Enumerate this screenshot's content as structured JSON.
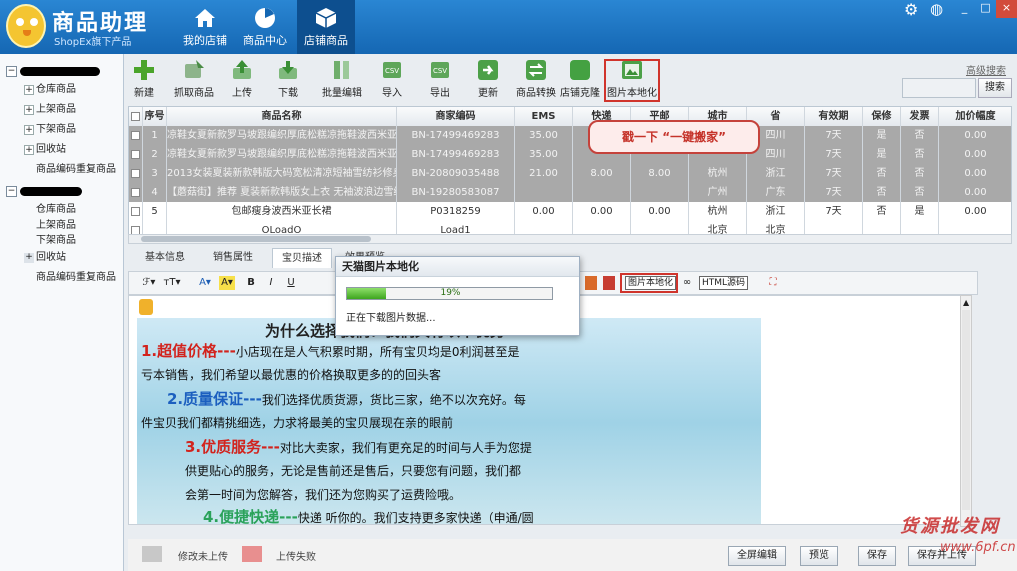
{
  "app": {
    "title": "商品助理",
    "subtitle": "ShopEx旗下产品"
  },
  "nav": [
    {
      "label": "我的店铺",
      "icon": "home-icon"
    },
    {
      "label": "商品中心",
      "icon": "pie-chart-icon"
    },
    {
      "label": "店铺商品",
      "icon": "box-icon",
      "active": true
    }
  ],
  "window": {
    "min": "_",
    "restore": "□",
    "close": "×"
  },
  "sidebar": {
    "groups": [
      {
        "items": [
          "仓库商品",
          "上架商品",
          "下架商品",
          "回收站",
          "商品编码重复商品"
        ]
      },
      {
        "items": [
          "仓库商品",
          "上架商品",
          "下架商品",
          "回收站",
          "商品编码重复商品"
        ]
      }
    ]
  },
  "toolbar": {
    "buttons": [
      "新建",
      "抓取商品",
      "上传",
      "下载",
      "批量编辑",
      "导入",
      "导出",
      "更新",
      "商品转换",
      "店铺克隆",
      "图片本地化"
    ],
    "advanced_search": "高级搜索",
    "search_button": "搜索"
  },
  "grid": {
    "columns": [
      "序号",
      "商品名称",
      "商家编码",
      "EMS",
      "快递",
      "平邮",
      "城市",
      "省",
      "有效期",
      "保修",
      "发票",
      "加价幅度"
    ],
    "rows": [
      [
        "1",
        "凉鞋女夏新款罗马坡跟编织厚底松糕凉拖鞋波西米亚",
        "BN-17499469283",
        "35.00",
        "",
        "",
        "",
        "四川",
        "7天",
        "是",
        "否",
        "0.00"
      ],
      [
        "2",
        "凉鞋女夏新款罗马坡跟编织厚底松糕凉拖鞋波西米亚",
        "BN-17499469283",
        "35.00",
        "",
        "",
        "",
        "四川",
        "7天",
        "是",
        "否",
        "0.00"
      ],
      [
        "3",
        "2013女装夏装新款韩版大码宽松清凉短袖雪纺衫修身",
        "BN-20809035488",
        "21.00",
        "8.00",
        "8.00",
        "杭州",
        "浙江",
        "7天",
        "否",
        "否",
        "0.00"
      ],
      [
        "4",
        "【蘑菇街】推荐 夏装新款韩版女上衣 无袖波浪边雪纺",
        "BN-19280583087",
        "",
        "",
        "",
        "广州",
        "广东",
        "7天",
        "否",
        "否",
        "0.00"
      ],
      [
        "5",
        "包邮瘦身波西米亚长裙",
        "P0318259",
        "0.00",
        "0.00",
        "0.00",
        "杭州",
        "浙江",
        "7天",
        "否",
        "是",
        "0.00"
      ],
      [
        "",
        "OLoadO",
        "Load1",
        "",
        "",
        "",
        "北京",
        "北京",
        "",
        "",
        "",
        ""
      ]
    ]
  },
  "callout": "戳一下 “一键搬家”",
  "tabs": [
    "基本信息",
    "销售属性",
    "宝贝描述",
    "效果预览"
  ],
  "editor_toolbar": {
    "image_localize": "图片本地化",
    "html_source": "HTML源码",
    "bold": "B",
    "italic": "I",
    "underline": "U"
  },
  "dialog": {
    "title": "天猫图片本地化",
    "progress": 0.19,
    "progress_text": "19%",
    "status": "正在下载图片数据..."
  },
  "banner": {
    "title": "为什么选择我们？我们具有以下优势",
    "lines": [
      {
        "head": "1.超值价格---",
        "text": "小店现在是人气积累时期，所有宝贝均是0利润甚至是"
      },
      {
        "head": "",
        "text": "亏本销售，我们希望以最优惠的价格换取更多的的回头客"
      },
      {
        "head": "2.质量保证---",
        "text": "我们选择优质货源，货比三家，绝不以次充好。每"
      },
      {
        "head": "",
        "text": "件宝贝我们都精挑细选，力求将最美的宝贝展现在亲的眼前"
      },
      {
        "head": "3.优质服务---",
        "text": "对比大卖家，我们有更充足的时间与人手为您提"
      },
      {
        "head": "",
        "text": "供更贴心的服务，无论是售前还是售后，只要您有问题，我们都"
      },
      {
        "head": "",
        "text": "会第一时间为您解答，我们还为您购买了运费险哦。"
      },
      {
        "head": "4.便捷快递---",
        "text": "快递 听你的。我们支持更多家快递（申通/圆"
      }
    ]
  },
  "bottom": {
    "legend": [
      {
        "label": "修改未上传",
        "color": "#c8c8c8"
      },
      {
        "label": "上传失败",
        "color": "#e88f8f"
      }
    ],
    "buttons": [
      "全屏编辑",
      "预览",
      "保存",
      "保存并上传"
    ]
  },
  "watermark": {
    "line1": "货源批发网",
    "line2": "www.6pf.cn"
  }
}
